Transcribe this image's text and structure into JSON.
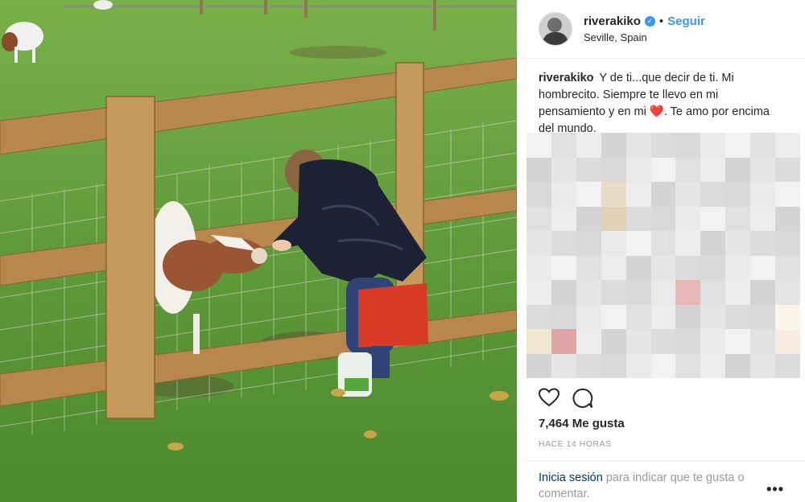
{
  "post": {
    "username": "riverakiko",
    "follow_label": "Seguir",
    "separator": "•",
    "location": "Seville, Spain",
    "caption_text_before_emoji": "Y de ti...que decir de ti. Mi hombrecito. Siempre te llevo en mi pensamiento y en mi ",
    "caption_emoji": "❤️",
    "caption_text_after_emoji": ". Te amo por encima del mundo.",
    "likes": "7,464 Me gusta",
    "timestamp": "HACE 14 HORAS",
    "login_link": "Inicia sesión",
    "login_rest": " para indicar que te gusta o comentar.",
    "more": "•••"
  },
  "icons": [
    "verified-badge-icon",
    "heart-icon",
    "comment-icon"
  ],
  "colors": {
    "link": "#3897f0",
    "text": "#262626",
    "muted": "#999999",
    "login_link": "#003569"
  }
}
